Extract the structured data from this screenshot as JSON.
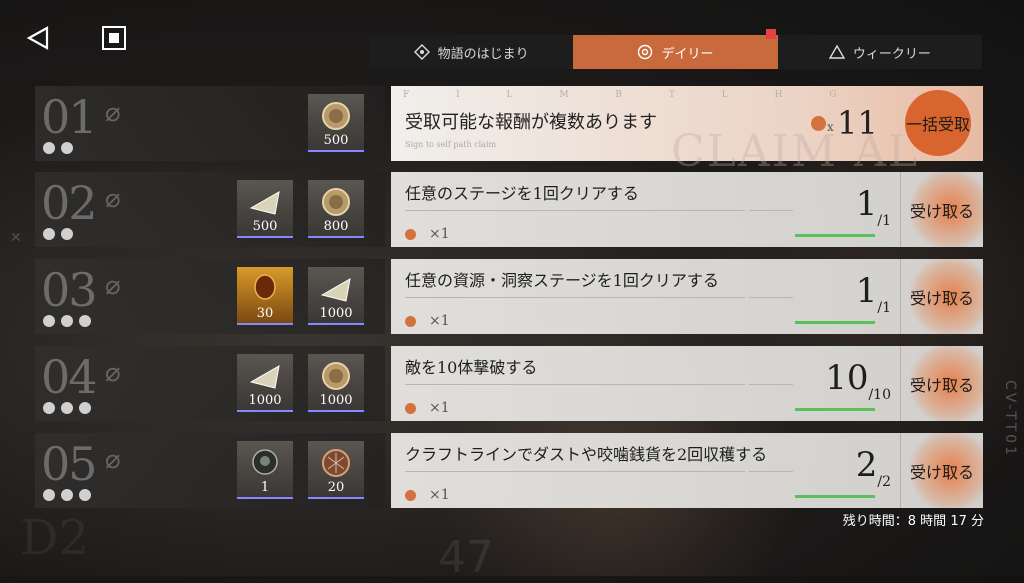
{
  "tabs": [
    {
      "label": "物語のはじまり",
      "icon": "diamond-icon",
      "active": false
    },
    {
      "label": "デイリー",
      "icon": "circle-icon",
      "active": true
    },
    {
      "label": "ウィークリー",
      "icon": "triangle-icon",
      "active": false
    }
  ],
  "highlight": {
    "number": "01",
    "text": "受取可能な報酬が複数あります",
    "count": "11",
    "x": "x",
    "claim_all": "一括受取",
    "deco": "F I L M B T L H G",
    "claim_text": "CLAIM AL",
    "note": "Sign to self path claim",
    "reward": {
      "qty": "500",
      "icon": "coin-icon"
    }
  },
  "tasks": [
    {
      "number": "02",
      "title": "任意のステージを1回クリアする",
      "sub_qty": "×1",
      "progress": "1",
      "total": "1",
      "claim": "受け取る",
      "rewards": [
        {
          "qty": "500",
          "icon": "crystal-icon"
        },
        {
          "qty": "800",
          "icon": "coin-icon"
        }
      ]
    },
    {
      "number": "03",
      "title": "任意の資源・洞察ステージを1回クリアする",
      "sub_qty": "×1",
      "progress": "1",
      "total": "1",
      "claim": "受け取る",
      "rewards": [
        {
          "qty": "30",
          "icon": "amber-gem-icon"
        },
        {
          "qty": "1000",
          "icon": "crystal-icon"
        }
      ]
    },
    {
      "number": "04",
      "title": "敵を10体撃破する",
      "sub_qty": "×1",
      "progress": "10",
      "total": "10",
      "claim": "受け取る",
      "rewards": [
        {
          "qty": "1000",
          "icon": "crystal-icon"
        },
        {
          "qty": "1000",
          "icon": "coin-icon"
        }
      ]
    },
    {
      "number": "05",
      "title": "クラフトラインでダストや咬噛銭貨を2回収穫する",
      "sub_qty": "×1",
      "progress": "2",
      "total": "2",
      "claim": "受け取る",
      "rewards": [
        {
          "qty": "1",
          "icon": "skull-orb-icon"
        },
        {
          "qty": "20",
          "icon": "shell-icon"
        }
      ]
    }
  ],
  "remaining": "残り時間：8 時間 17 分",
  "side_label": "CV-TT01",
  "watermark": "47",
  "watermark2": "D2",
  "colors": {
    "accent": "#c86a3c",
    "progress": "#5bbf5a",
    "badge": "#e5423b"
  }
}
